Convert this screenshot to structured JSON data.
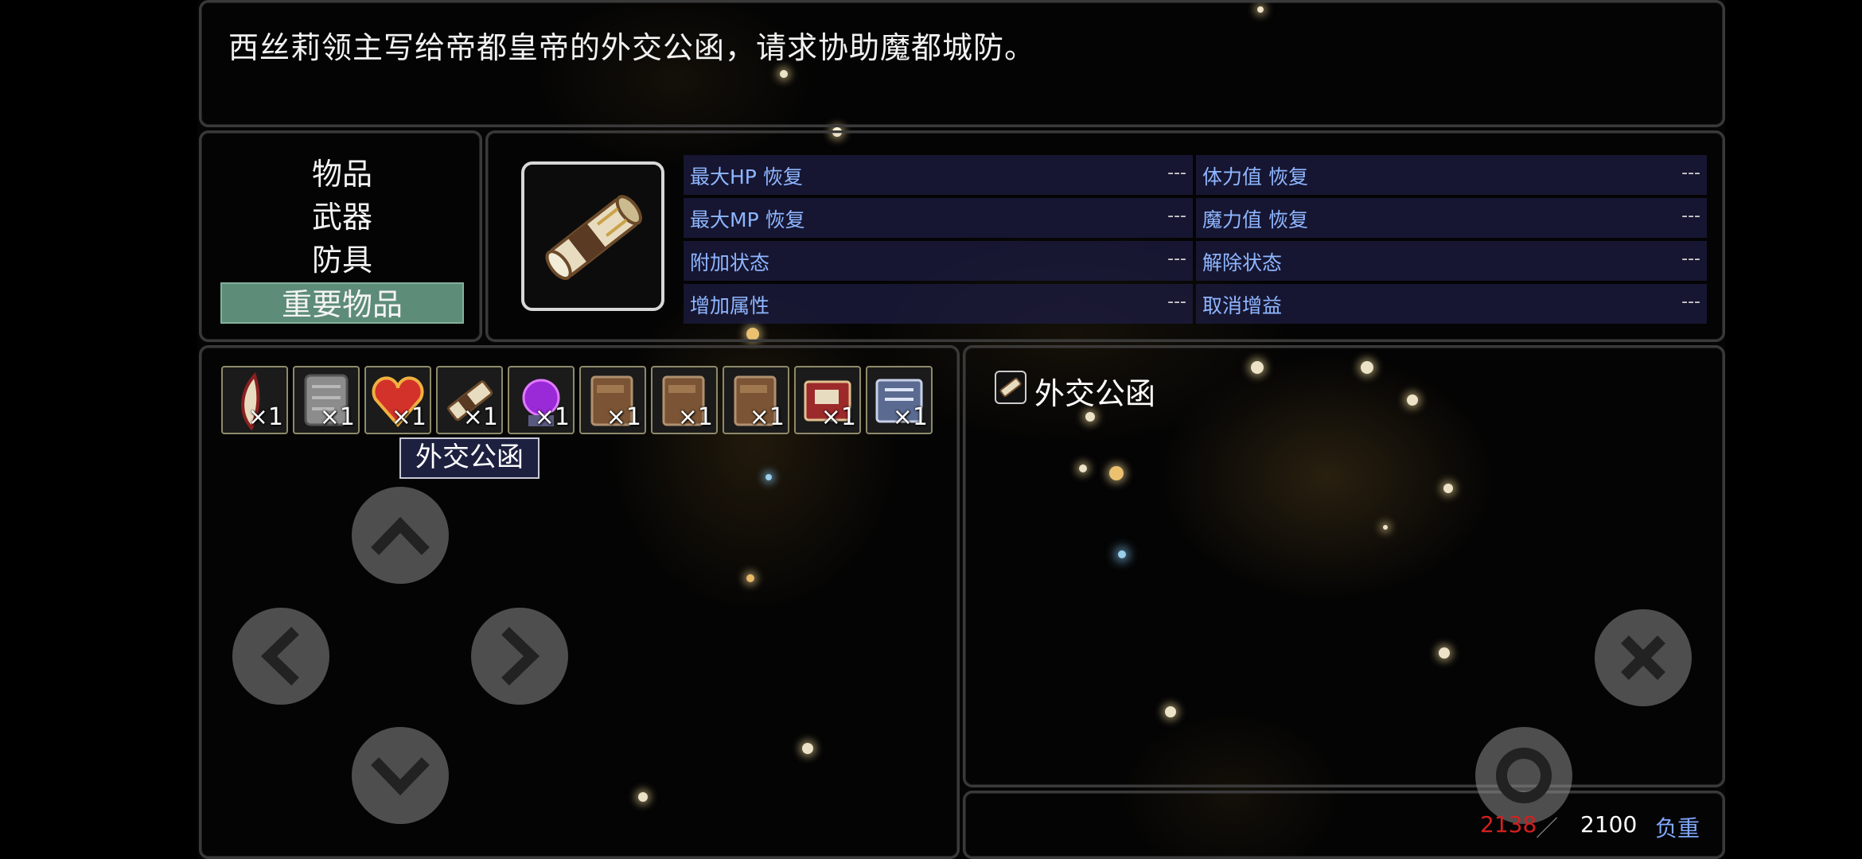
{
  "help": {
    "text": "西丝莉领主写给帝都皇帝的外交公函，请求协助魔都城防。"
  },
  "categories": [
    {
      "label": "物品",
      "selected": false
    },
    {
      "label": "武器",
      "selected": false
    },
    {
      "label": "防具",
      "selected": false
    },
    {
      "label": "重要物品",
      "selected": true
    }
  ],
  "status": {
    "left": [
      {
        "label": "最大HP 恢复",
        "value": "---"
      },
      {
        "label": "最大MP 恢复",
        "value": "---"
      },
      {
        "label": "附加状态",
        "value": "---"
      },
      {
        "label": "增加属性",
        "value": "---"
      }
    ],
    "right": [
      {
        "label": "体力值 恢复",
        "value": "---"
      },
      {
        "label": "魔力值 恢复",
        "value": "---"
      },
      {
        "label": "解除状态",
        "value": "---"
      },
      {
        "label": "取消增益",
        "value": "---"
      }
    ]
  },
  "inventory": {
    "items": [
      {
        "icon": "feather-icon",
        "count": "×1"
      },
      {
        "icon": "stone-tablet-icon",
        "count": "×1"
      },
      {
        "icon": "heart-gem-icon",
        "count": "×1"
      },
      {
        "icon": "scroll-icon",
        "count": "×1"
      },
      {
        "icon": "purple-orb-icon",
        "count": "×1"
      },
      {
        "icon": "book-icon",
        "count": "×1"
      },
      {
        "icon": "book-icon",
        "count": "×1"
      },
      {
        "icon": "book-icon",
        "count": "×1"
      },
      {
        "icon": "red-book-icon",
        "count": "×1"
      },
      {
        "icon": "blue-book-icon",
        "count": "×1"
      }
    ],
    "selected_index": 3,
    "tooltip": "外交公函"
  },
  "detail": {
    "name": "外交公函",
    "icon": "scroll-icon"
  },
  "weight": {
    "current": "2138",
    "separator": "／",
    "max": "2100",
    "label": "负重",
    "current_color": "#d32020",
    "label_color": "#7fa8ff"
  },
  "controls": {
    "up": "arrow-up-icon",
    "down": "arrow-down-icon",
    "left": "arrow-left-icon",
    "right": "arrow-right-icon",
    "cancel": "close-icon",
    "confirm": "circle-icon"
  }
}
